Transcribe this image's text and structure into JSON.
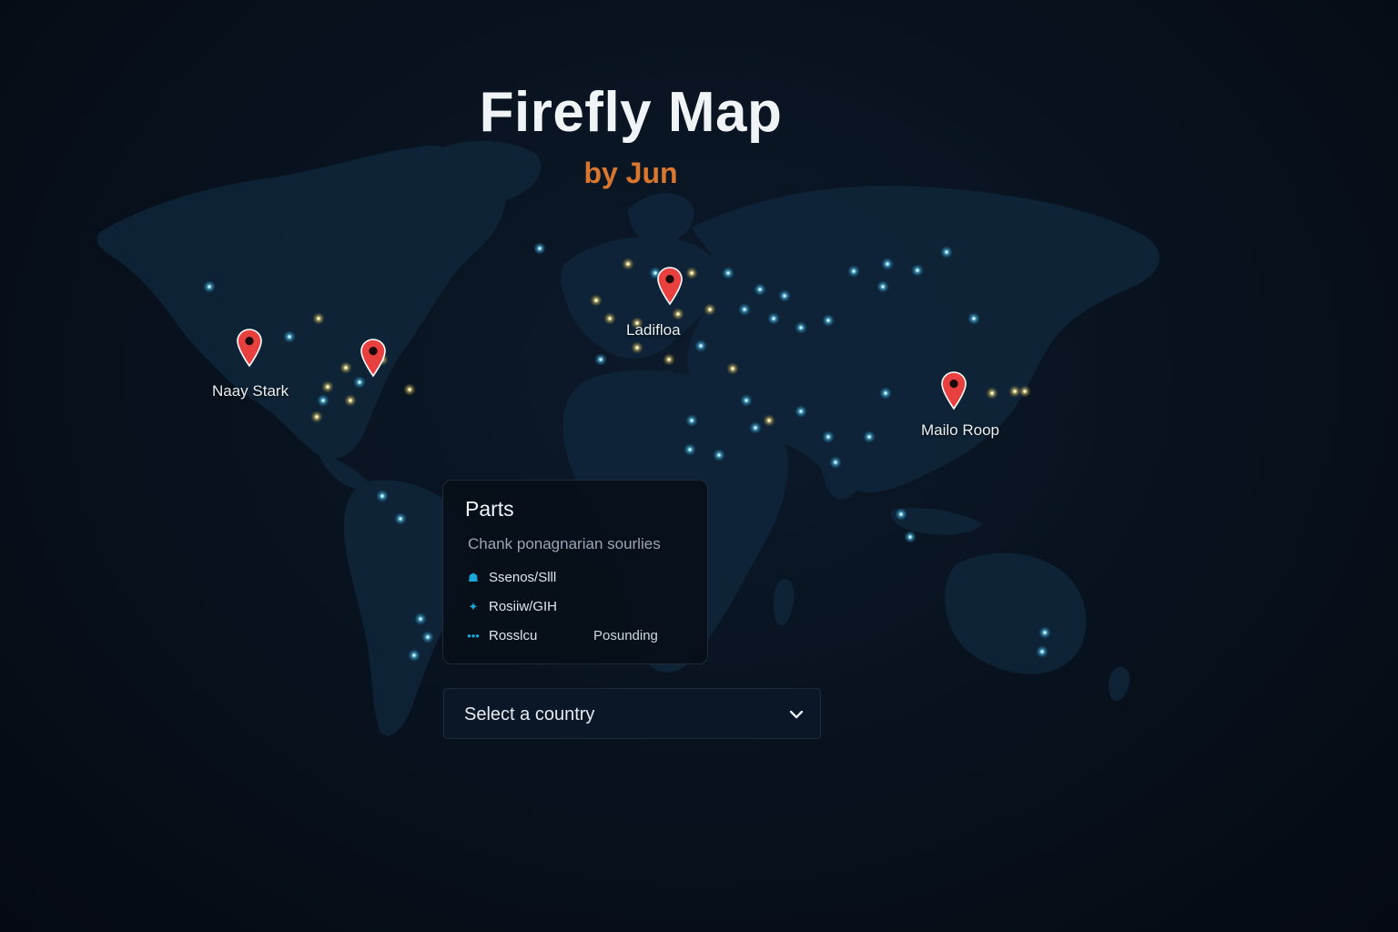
{
  "header": {
    "title": "Firefly Map",
    "subtitle": "by Jun"
  },
  "markers": [
    {
      "label": "Naay Stark"
    },
    {
      "label": ""
    },
    {
      "label": "Ladifloa"
    },
    {
      "label": "Mailo Roop"
    }
  ],
  "panel": {
    "title": "Parts",
    "description": "Chank ponagnarian sourlies",
    "items": [
      {
        "icon": "bookmark-icon",
        "label": "Ssenos/Slll"
      },
      {
        "icon": "twitter-icon",
        "label": "Rosiiw/GIH"
      },
      {
        "icon": "dots-icon",
        "label": "Rosslcu",
        "value": "Posunding"
      }
    ]
  },
  "country_select": {
    "placeholder": "Select a country"
  },
  "colors": {
    "background": "#08111d",
    "land": "#0f2438",
    "pin": "#e8403f",
    "title": "#f1f4f7",
    "accent": "#d9772e",
    "light_dot": "#6fd3ff"
  }
}
